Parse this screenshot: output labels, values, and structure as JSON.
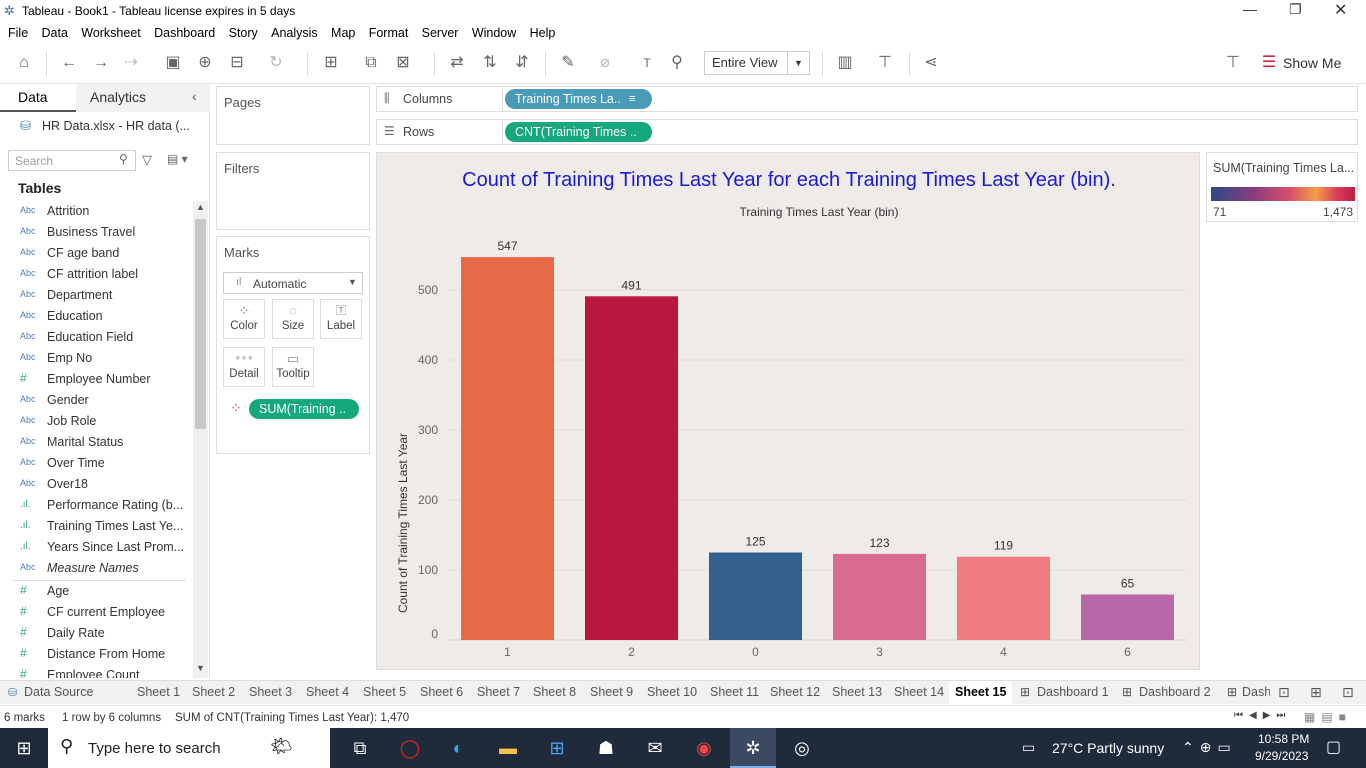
{
  "window": {
    "title": "Tableau - Book1 - Tableau license expires in 5 days"
  },
  "menu": [
    "File",
    "Data",
    "Worksheet",
    "Dashboard",
    "Story",
    "Analysis",
    "Map",
    "Format",
    "Server",
    "Window",
    "Help"
  ],
  "toolbar": {
    "fit_mode": "Entire View",
    "show_me": "Show Me"
  },
  "data_pane": {
    "tab_data": "Data",
    "tab_analytics": "Analytics",
    "source": "HR Data.xlsx - HR data (...",
    "search_placeholder": "Search",
    "tables_label": "Tables",
    "dimensions": [
      {
        "type": "Abc",
        "name": "Attrition"
      },
      {
        "type": "Abc",
        "name": "Business Travel"
      },
      {
        "type": "Abc",
        "name": "CF age band"
      },
      {
        "type": "Abc",
        "name": "CF attrition label"
      },
      {
        "type": "Abc",
        "name": "Department"
      },
      {
        "type": "Abc",
        "name": "Education"
      },
      {
        "type": "Abc",
        "name": "Education Field"
      },
      {
        "type": "Abc",
        "name": "Emp No"
      },
      {
        "type": "#",
        "name": "Employee Number"
      },
      {
        "type": "Abc",
        "name": "Gender"
      },
      {
        "type": "Abc",
        "name": "Job Role"
      },
      {
        "type": "Abc",
        "name": "Marital Status"
      },
      {
        "type": "Abc",
        "name": "Over Time"
      },
      {
        "type": "Abc",
        "name": "Over18"
      },
      {
        "type": "bin",
        "name": "Performance Rating (b..."
      },
      {
        "type": "bin",
        "name": "Training Times Last Ye..."
      },
      {
        "type": "bin",
        "name": "Years Since Last Prom..."
      },
      {
        "type": "Abc",
        "name": "Measure Names"
      }
    ],
    "measures": [
      {
        "type": "#",
        "name": "Age"
      },
      {
        "type": "#",
        "name": "CF current Employee"
      },
      {
        "type": "#",
        "name": "Daily Rate"
      },
      {
        "type": "#",
        "name": "Distance From Home"
      },
      {
        "type": "#",
        "name": "Employee Count"
      }
    ]
  },
  "shelves": {
    "pages": "Pages",
    "filters": "Filters",
    "marks": "Marks",
    "columns_label": "Columns",
    "rows_label": "Rows",
    "columns_pill": "Training Times La..",
    "rows_pill": "CNT(Training Times ..",
    "mark_type": "Automatic",
    "mark_buttons": [
      "Color",
      "Size",
      "Label",
      "Detail",
      "Tooltip"
    ],
    "color_pill": "SUM(Training .."
  },
  "legend": {
    "title": "SUM(Training Times La...",
    "min": "71",
    "max": "1,473"
  },
  "chart_data": {
    "type": "bar",
    "title": "Count of Training Times Last Year for each Training Times Last Year (bin).",
    "xlabel": "Training Times Last Year (bin)",
    "ylabel": "Count of Training Times Last Year",
    "categories": [
      "1",
      "2",
      "0",
      "3",
      "4",
      "6"
    ],
    "values": [
      547,
      491,
      125,
      123,
      119,
      65
    ],
    "colors": [
      "#e8694a",
      "#b8173f",
      "#34608f",
      "#d86b8f",
      "#f07b80",
      "#b868a8"
    ],
    "yticks": [
      0,
      100,
      200,
      300,
      400,
      500
    ],
    "ylim": [
      0,
      570
    ],
    "grid": true
  },
  "sheet_tabs": [
    "Data Source",
    "Sheet 1",
    "Sheet 2",
    "Sheet 3",
    "Sheet 4",
    "Sheet 5",
    "Sheet 6",
    "Sheet 7",
    "Sheet 8",
    "Sheet 9",
    "Sheet 10",
    "Sheet 11",
    "Sheet 12",
    "Sheet 13",
    "Sheet 14",
    "Sheet 15",
    "Dashboard 1",
    "Dashboard 2",
    "Dash"
  ],
  "active_sheet": "Sheet 15",
  "status": {
    "marks": "6 marks",
    "rows": "1 row by 6 columns",
    "sum": "SUM of CNT(Training Times Last Year): 1,470"
  },
  "taskbar": {
    "search_placeholder": "Type here to search",
    "weather": "27°C  Partly sunny",
    "time": "10:58 PM",
    "date": "9/29/2023"
  }
}
